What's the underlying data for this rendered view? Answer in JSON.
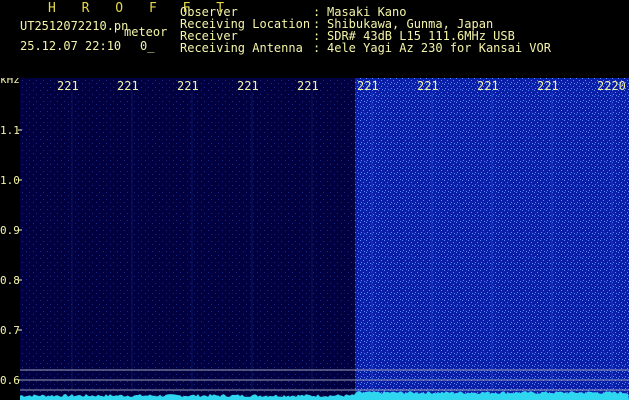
{
  "header": {
    "brand": "H R O F F T",
    "filename": "UT2512072210.pn",
    "mode": "meteor",
    "datetime": "25.12.07 22:10",
    "counter": "0_",
    "meta": [
      {
        "label": "Observer",
        "value": "Masaki Kano"
      },
      {
        "label": "Receiving Location",
        "value": "Shibukawa, Gunma, Japan"
      },
      {
        "label": "Receiver",
        "value": "SDR# 43dB L15 111.6MHz USB"
      },
      {
        "label": "Receiving Antenna",
        "value": "4ele Yagi Az 230 for Kansai VOR"
      }
    ],
    "separator": ":"
  },
  "spectrogram": {
    "y_unit": "kHz",
    "x_ticks": [
      "221",
      "221",
      "221",
      "221",
      "221",
      "221",
      "221",
      "221",
      "221",
      "2220"
    ],
    "y_ticks": [
      "1.1",
      "1.0",
      "0.9",
      "0.8",
      "0.7",
      "0.6"
    ],
    "y_values": [
      1.1,
      1.0,
      0.9,
      0.8,
      0.7,
      0.6
    ],
    "colors": {
      "axis_text": "#f4f4a8",
      "background_dark": "#000040",
      "background_bright": "#0a1ea8",
      "noise_bright": "#5a8cff",
      "reference_line": "#9aa0b4",
      "level_trace": "#2fd6f0"
    }
  }
}
